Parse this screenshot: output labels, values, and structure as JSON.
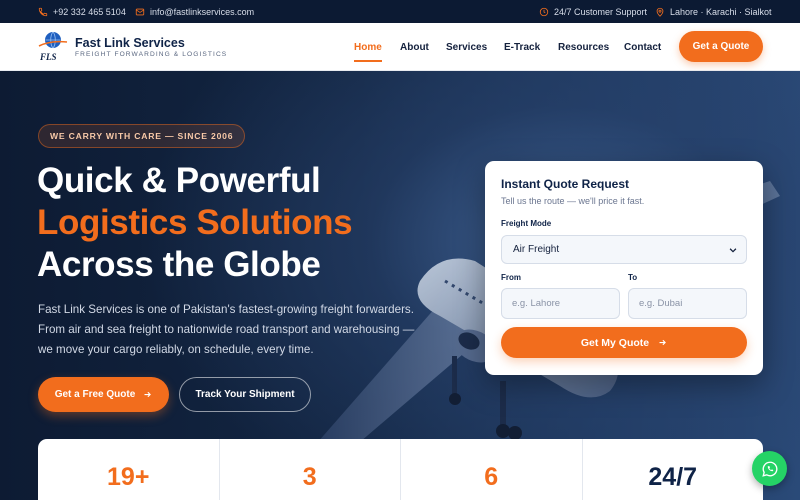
{
  "topbar": {
    "phone": "+92 332 465 5104",
    "email": "info@fastlinkservices.com",
    "support": "24/7 Customer Support",
    "locations": "Lahore · Karachi · Sialkot"
  },
  "header": {
    "brand_name": "Fast Link Services",
    "brand_tagline": "FREIGHT FORWARDING & LOGISTICS",
    "logo_text": "FLS",
    "nav": [
      "Home",
      "About",
      "Services",
      "E-Track",
      "Resources",
      "Contact"
    ],
    "active_nav": "Home",
    "cta_label": "Get a Quote"
  },
  "hero": {
    "badge": "WE CARRY WITH CARE — SINCE 2006",
    "headline_line1": "Quick & Powerful",
    "headline_line2": "Logistics Solutions",
    "headline_line3": "Across the Globe",
    "description": "Fast Link Services is one of Pakistan's fastest-growing freight forwarders. From air and sea freight to nationwide road transport and warehousing — we move your cargo reliably, on schedule, every time.",
    "primary_button": "Get a Free Quote",
    "secondary_button": "Track Your Shipment"
  },
  "quote_card": {
    "title": "Instant Quote Request",
    "subtitle": "Tell us the route — we'll price it fast.",
    "freight_mode_label": "Freight Mode",
    "freight_mode_value": "Air Freight",
    "from_label": "From",
    "from_placeholder": "e.g. Lahore",
    "to_label": "To",
    "to_placeholder": "e.g. Dubai",
    "submit_label": "Get My Quote"
  },
  "stats": [
    "19+",
    "3",
    "6",
    "24/7"
  ],
  "colors": {
    "accent": "#f26d1d",
    "navy": "#0f2347",
    "topbar_bg": "#0c1a33",
    "whatsapp": "#25d366"
  },
  "icons": {
    "phone": "phone-icon",
    "email": "mail-icon",
    "support": "clock-icon",
    "location": "map-pin-icon",
    "arrow": "arrow-right-icon",
    "whatsapp": "whatsapp-icon"
  }
}
